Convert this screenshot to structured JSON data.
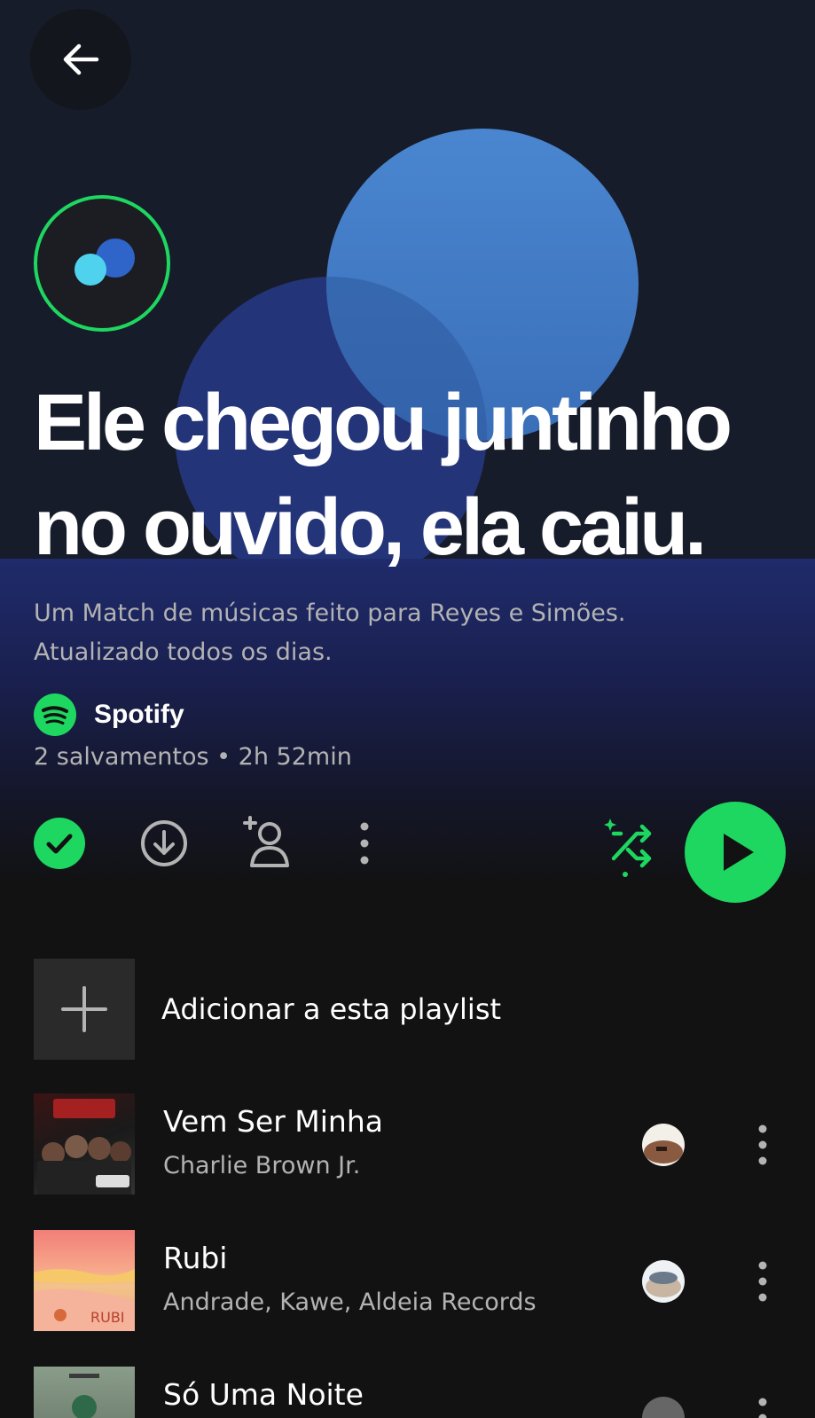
{
  "header": {
    "back_icon": "arrow-left-icon"
  },
  "playlist": {
    "badge_icon": "blend-icon",
    "title": "Ele chegou juntinho no ouvido, ela caiu.",
    "description_line1": "Um Match de músicas feito para Reyes e Simões.",
    "description_line2": "Atualizado todos os dias.",
    "owner": "Spotify",
    "meta": "2 salvamentos • 2h 52min"
  },
  "actions": {
    "saved_icon": "check-circle-icon",
    "download_icon": "download-icon",
    "invite_icon": "add-user-icon",
    "more_icon": "more-vertical-icon",
    "shuffle_icon": "smart-shuffle-icon",
    "play_icon": "play-icon"
  },
  "add_to_playlist": {
    "label": "Adicionar a esta playlist"
  },
  "tracks": [
    {
      "title": "Vem Ser Minha",
      "artist": "Charlie Brown Jr."
    },
    {
      "title": "Rubi",
      "artist": "Andrade, Kawe, Aldeia Records"
    },
    {
      "title": "Só Uma Noite",
      "artist": ""
    }
  ],
  "colors": {
    "accent": "#1ed760",
    "background": "#121212",
    "hero_bg": "#171c2a",
    "circle_light": "#4a86d0",
    "circle_dark": "#243479"
  }
}
